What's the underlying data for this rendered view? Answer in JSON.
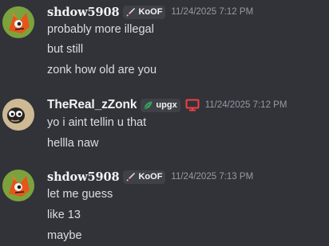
{
  "messages": [
    {
      "username": "shdow5908",
      "tag": "KoOF",
      "timestamp": "11/24/2025 7:12 PM",
      "lines": [
        "probably more illegal",
        "but still",
        "zonk how old are you"
      ]
    },
    {
      "username": "TheReal_zZonk",
      "tag": "upgx",
      "timestamp": "11/24/2025 7:12 PM",
      "lines": [
        "yo i aint tellin u that",
        "hellla naw"
      ]
    },
    {
      "username": "shdow5908",
      "tag": "KoOF",
      "timestamp": "11/24/2025 7:13 PM",
      "lines": [
        "let me guess",
        "like 13",
        "maybe"
      ]
    }
  ],
  "icons": {
    "tag1": "sword-icon",
    "tag2": "leaf-icon",
    "device": "desktop-icon",
    "device_color": "#f23f43"
  }
}
